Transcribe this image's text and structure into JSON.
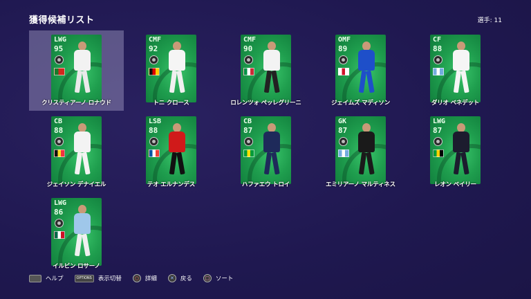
{
  "header": {
    "title": "獲得候補リスト",
    "count_label": "選手: 11"
  },
  "players": [
    {
      "position": "LWG",
      "rating": "95",
      "name": "クリスティアーノ ロナウド",
      "flag": [
        "#1a7a2a",
        "#1a7a2a",
        "#d2281e",
        "#d2281e",
        "#d2281e"
      ],
      "kit": "#f2f2f2",
      "shorts": "#eaeaea",
      "selected": true
    },
    {
      "position": "CMF",
      "rating": "92",
      "name": "トニ クロース",
      "flag": [
        "#111111",
        "#dd0000",
        "#ffce00"
      ],
      "kit": "#f5f5f5",
      "shorts": "#f0f0f0",
      "selected": false
    },
    {
      "position": "CMF",
      "rating": "90",
      "name": "ロレンツォ ペッレグリーニ",
      "flag": [
        "#009246",
        "#ffffff",
        "#ce2b37"
      ],
      "kit": "#f3f3f3",
      "shorts": "#222222",
      "selected": false
    },
    {
      "position": "OMF",
      "rating": "89",
      "name": "ジェイムズ マディソン",
      "flag": [
        "#ffffff",
        "#cf142b",
        "#ffffff"
      ],
      "kit": "#1e4fc9",
      "shorts": "#1e4fc9",
      "selected": false
    },
    {
      "position": "CF",
      "rating": "88",
      "name": "ダリオ ベネデット",
      "flag": [
        "#74acdf",
        "#ffffff",
        "#74acdf"
      ],
      "kit": "#f5f5f5",
      "shorts": "#f5f5f5",
      "selected": false
    },
    {
      "position": "CB",
      "rating": "88",
      "name": "ジェイソン デナイエル",
      "flag": [
        "#111111",
        "#fdda24",
        "#ef3340"
      ],
      "kit": "#f3f3f3",
      "shorts": "#f3f3f3",
      "selected": false
    },
    {
      "position": "LSB",
      "rating": "88",
      "name": "テオ エルナンデス",
      "flag": [
        "#0055a4",
        "#ffffff",
        "#ef4135"
      ],
      "kit": "#d01a1a",
      "shorts": "#111111",
      "selected": false
    },
    {
      "position": "CB",
      "rating": "87",
      "name": "ハファエウ トロイ",
      "flag": [
        "#009b3a",
        "#fedf00",
        "#009b3a"
      ],
      "kit": "#1e2a5a",
      "shorts": "#1e2a5a",
      "selected": false
    },
    {
      "position": "GK",
      "rating": "87",
      "name": "エミリアーノ マルティネス",
      "flag": [
        "#74acdf",
        "#ffffff",
        "#74acdf"
      ],
      "kit": "#1a1a1a",
      "shorts": "#1a1a1a",
      "selected": false
    },
    {
      "position": "LWG",
      "rating": "87",
      "name": "レオン ベイリー",
      "flag": [
        "#009b3a",
        "#fed100",
        "#000000"
      ],
      "kit": "#1c1c2e",
      "shorts": "#1c1c2e",
      "selected": false
    },
    {
      "position": "LWG",
      "rating": "86",
      "name": "イルビン ロサーノ",
      "flag": [
        "#006847",
        "#ffffff",
        "#ce1126"
      ],
      "kit": "#9fc7ea",
      "shorts": "#f0f0f0",
      "selected": false
    }
  ],
  "footer": {
    "help_label": "ヘルプ",
    "options_icon_text": "OPTIONS",
    "toggle_label": "表示切替",
    "detail_label": "詳細",
    "back_label": "戻る",
    "sort_label": "ソート"
  }
}
